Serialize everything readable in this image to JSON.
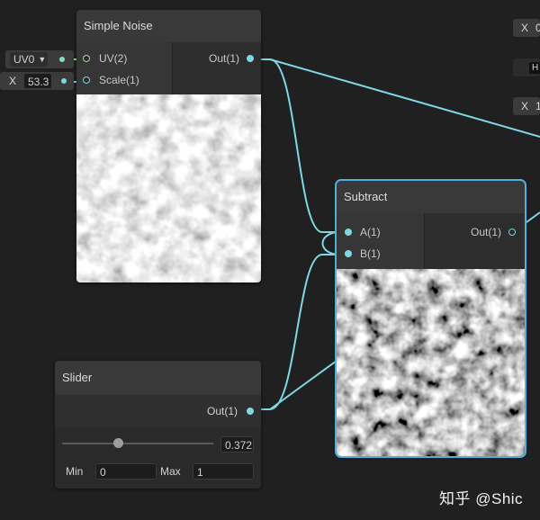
{
  "simple_noise": {
    "title": "Simple Noise",
    "in_uv": "UV(2)",
    "in_scale": "Scale(1)",
    "out": "Out(1)"
  },
  "uv_input": {
    "value": "UV0"
  },
  "scale_input": {
    "axis": "X",
    "value": "53.3"
  },
  "subtract": {
    "title": "Subtract",
    "in_a": "A(1)",
    "in_b": "B(1)",
    "out": "Out(1)"
  },
  "slider_node": {
    "title": "Slider",
    "out": "Out(1)",
    "value": "0.372",
    "value_fraction": 0.372,
    "min_label": "Min",
    "min_value": "0",
    "max_label": "Max",
    "max_value": "1"
  },
  "offscreen": {
    "x1": "X",
    "x1_value": "0",
    "hi_label": "H",
    "x2": "X",
    "x2_value": "1"
  },
  "watermark": "知乎 @Shic",
  "colors": {
    "wire": "#7fd7e3",
    "uv_wire": "#9ee38f",
    "selected": "#4fb0dc",
    "background": "#202020"
  }
}
